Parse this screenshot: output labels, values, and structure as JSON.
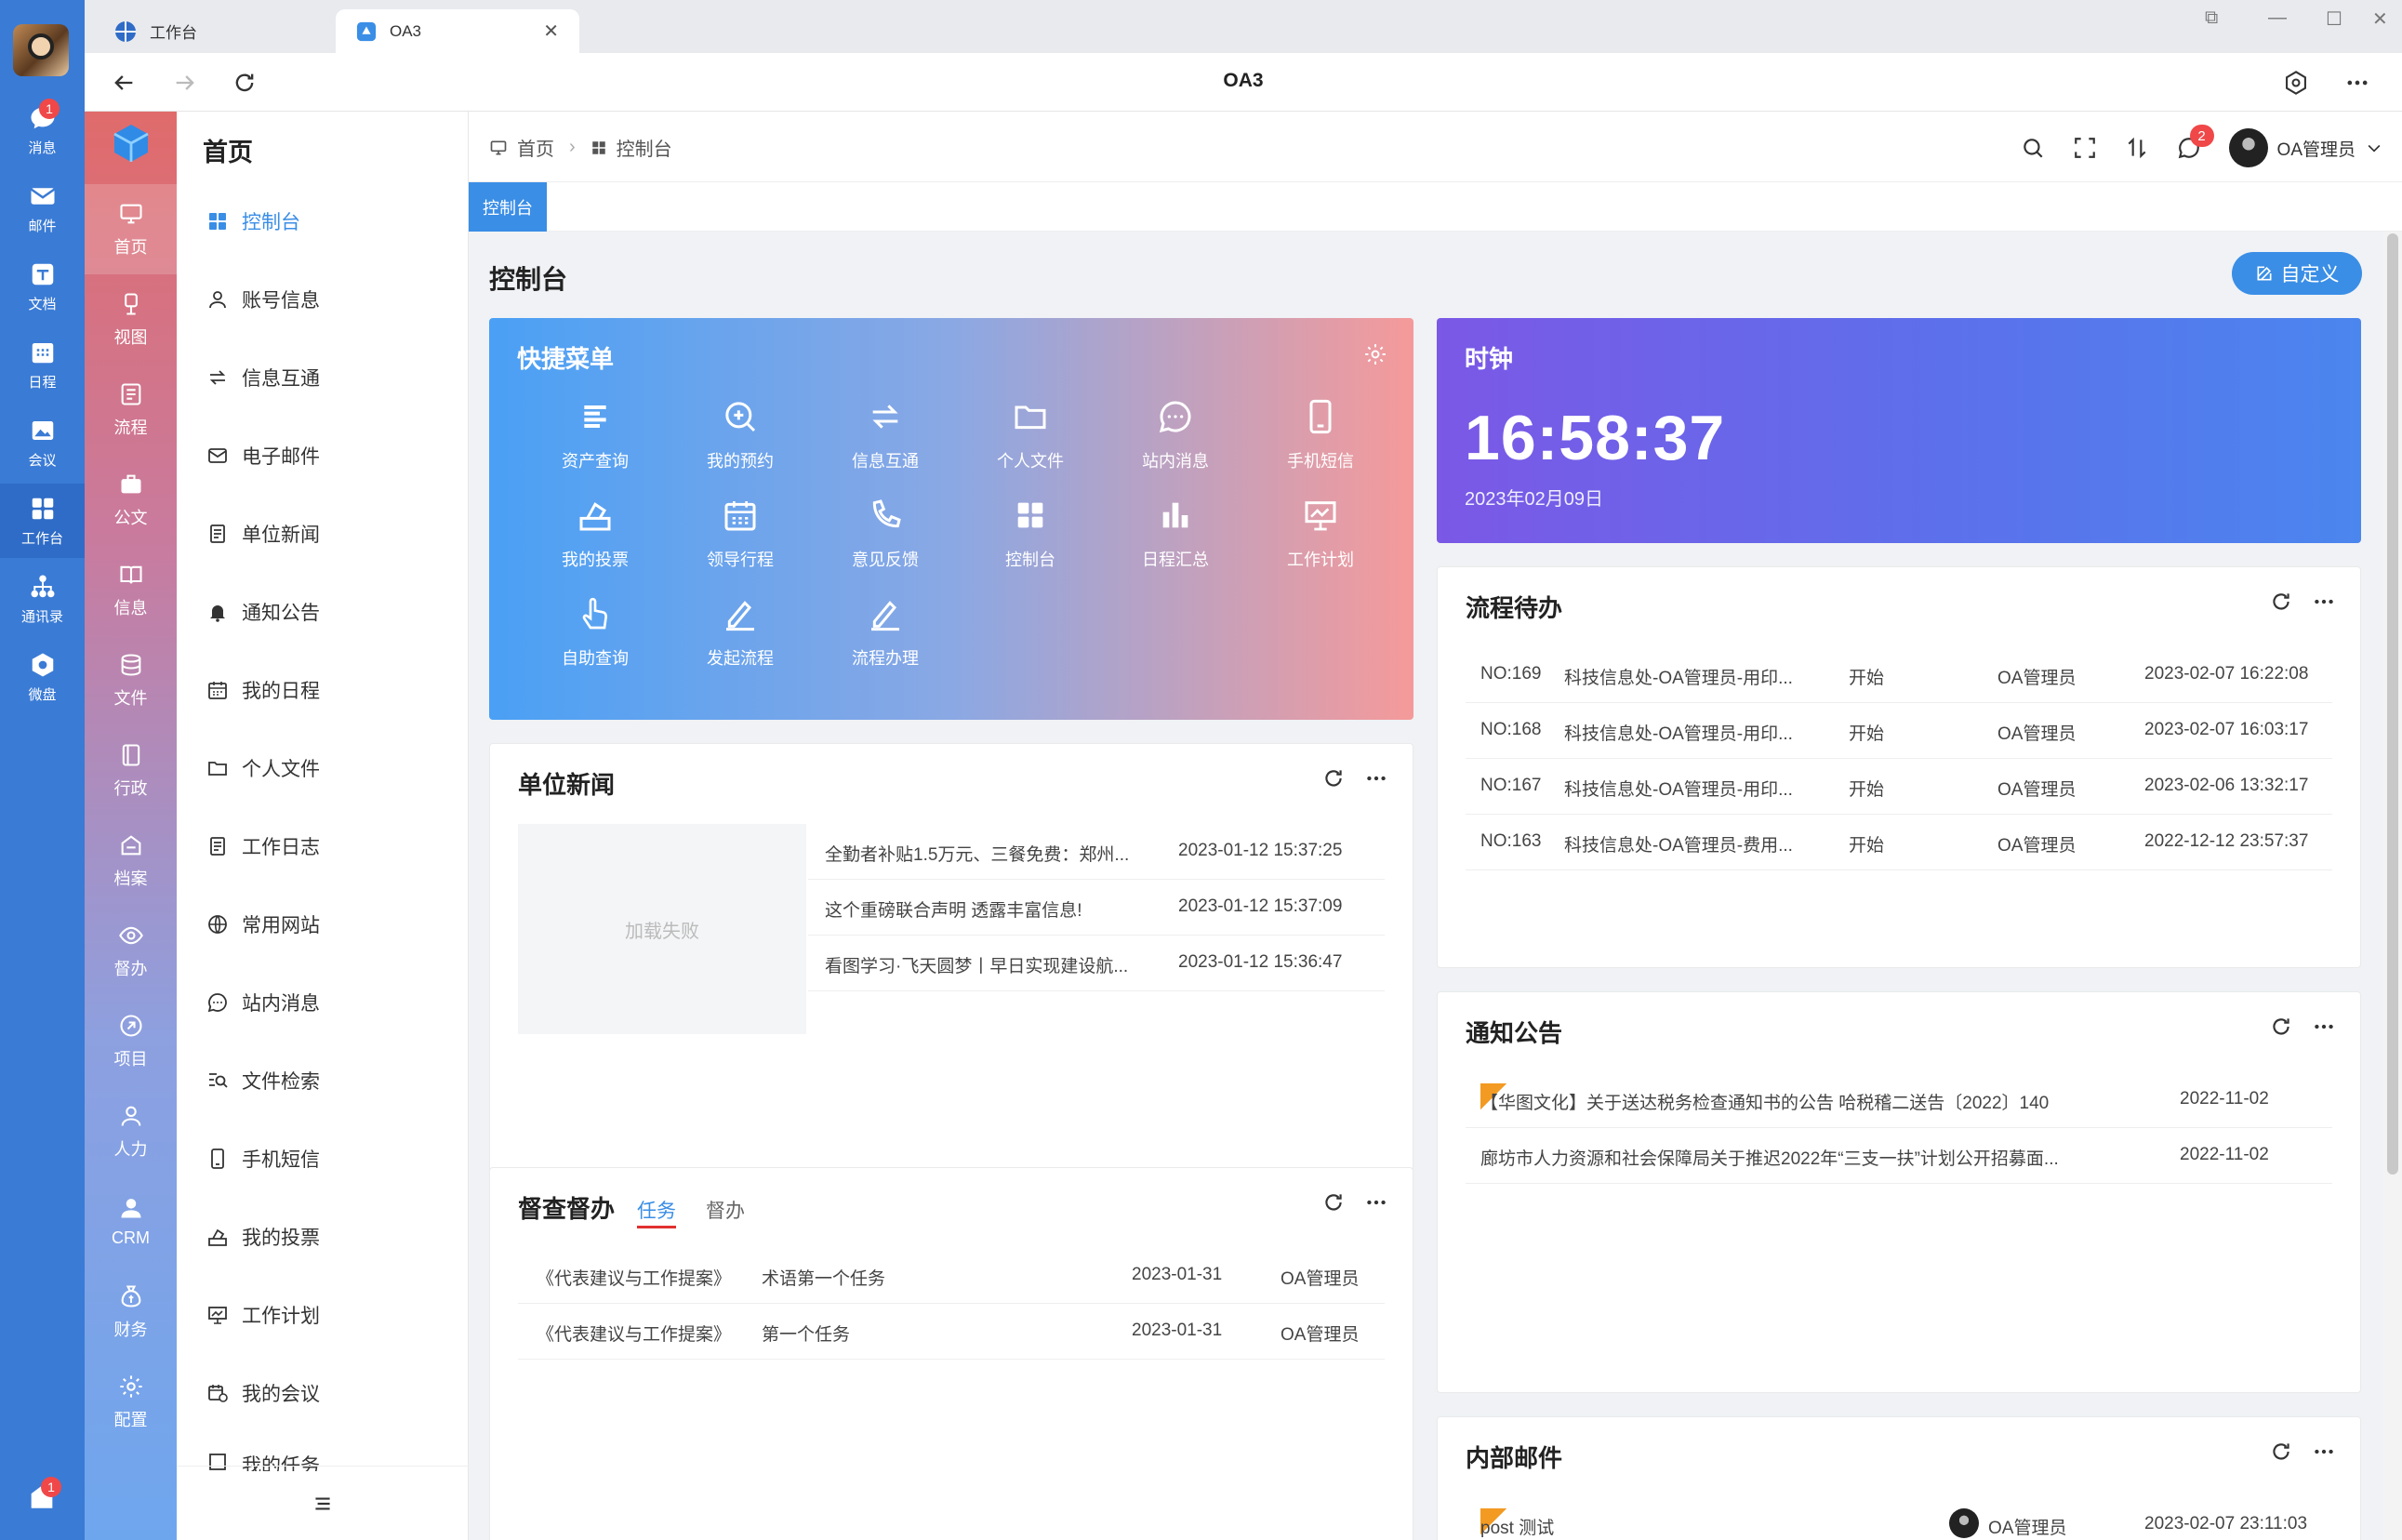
{
  "rail": {
    "items": [
      {
        "label": "消息",
        "badge": "1"
      },
      {
        "label": "邮件"
      },
      {
        "label": "文档"
      },
      {
        "label": "日程"
      },
      {
        "label": "会议"
      },
      {
        "label": "工作台"
      },
      {
        "label": "通讯录"
      },
      {
        "label": "微盘"
      }
    ],
    "bottom_badge": "1"
  },
  "browser": {
    "tabs": [
      {
        "label": "工作台"
      },
      {
        "label": "OA3"
      }
    ],
    "title": "OA3"
  },
  "menu1": {
    "items": [
      "首页",
      "视图",
      "流程",
      "公文",
      "信息",
      "文件",
      "行政",
      "档案",
      "督办",
      "项目",
      "人力",
      "CRM",
      "财务",
      "配置"
    ]
  },
  "menu2": {
    "heading": "首页",
    "items": [
      "控制台",
      "账号信息",
      "信息互通",
      "电子邮件",
      "单位新闻",
      "通知公告",
      "我的日程",
      "个人文件",
      "工作日志",
      "常用网站",
      "站内消息",
      "文件检索",
      "手机短信",
      "我的投票",
      "工作计划",
      "我的会议",
      "我的任务"
    ]
  },
  "topbar": {
    "breadcrumb": [
      "首页",
      "控制台"
    ],
    "notify_badge": "2",
    "user": "OA管理员"
  },
  "tag": "控制台",
  "page": {
    "title": "控制台",
    "custom_btn": "自定义"
  },
  "quick": {
    "title": "快捷菜单",
    "items": [
      "资产查询",
      "我的预约",
      "信息互通",
      "个人文件",
      "站内消息",
      "手机短信",
      "我的投票",
      "领导行程",
      "意见反馈",
      "控制台",
      "日程汇总",
      "工作计划",
      "自助查询",
      "发起流程",
      "流程办理"
    ]
  },
  "clock": {
    "title": "时钟",
    "time": "16:58:37",
    "date": "2023年02月09日"
  },
  "news": {
    "title": "单位新闻",
    "img_fail": "加载失败",
    "rows": [
      {
        "title": "全勤者补贴1.5万元、三餐免费：郑州...",
        "time": "2023-01-12 15:37:25"
      },
      {
        "title": "这个重磅联合声明 透露丰富信息!",
        "time": "2023-01-12 15:37:09"
      },
      {
        "title": "看图学习·飞天圆梦丨早日实现建设航...",
        "time": "2023-01-12 15:36:47"
      }
    ]
  },
  "todo": {
    "title": "流程待办",
    "rows": [
      {
        "no": "NO:169",
        "name": "科技信息处-OA管理员-用印...",
        "step": "开始",
        "user": "OA管理员",
        "time": "2023-02-07 16:22:08"
      },
      {
        "no": "NO:168",
        "name": "科技信息处-OA管理员-用印...",
        "step": "开始",
        "user": "OA管理员",
        "time": "2023-02-07 16:03:17"
      },
      {
        "no": "NO:167",
        "name": "科技信息处-OA管理员-用印...",
        "step": "开始",
        "user": "OA管理员",
        "time": "2023-02-06 13:32:17"
      },
      {
        "no": "NO:163",
        "name": "科技信息处-OA管理员-费用...",
        "step": "开始",
        "user": "OA管理员",
        "time": "2022-12-12 23:57:37"
      }
    ]
  },
  "notice": {
    "title": "通知公告",
    "rows": [
      {
        "title": "【华图文化】关于送达税务检查通知书的公告 哈税稽二送告〔2022〕140",
        "date": "2022-11-02"
      },
      {
        "title": "廊坊市人力资源和社会保障局关于推迟2022年“三支一扶”计划公开招募面...",
        "date": "2022-11-02"
      }
    ]
  },
  "supervise": {
    "title": "督查督办",
    "tabs": [
      "任务",
      "督办"
    ],
    "rows": [
      {
        "doc": "《代表建议与工作提案》",
        "task": "术语第一个任务",
        "date": "2023-01-31",
        "user": "OA管理员"
      },
      {
        "doc": "《代表建议与工作提案》",
        "task": "第一个任务",
        "date": "2023-01-31",
        "user": "OA管理员"
      }
    ]
  },
  "mail": {
    "title": "内部邮件",
    "rows": [
      {
        "subject": "post 测试",
        "user": "OA管理员",
        "time": "2023-02-07 23:11:03"
      }
    ]
  },
  "colors": {
    "rail": "#3a7bd5",
    "accent": "#3a8ee6",
    "badge": "#f04848"
  }
}
